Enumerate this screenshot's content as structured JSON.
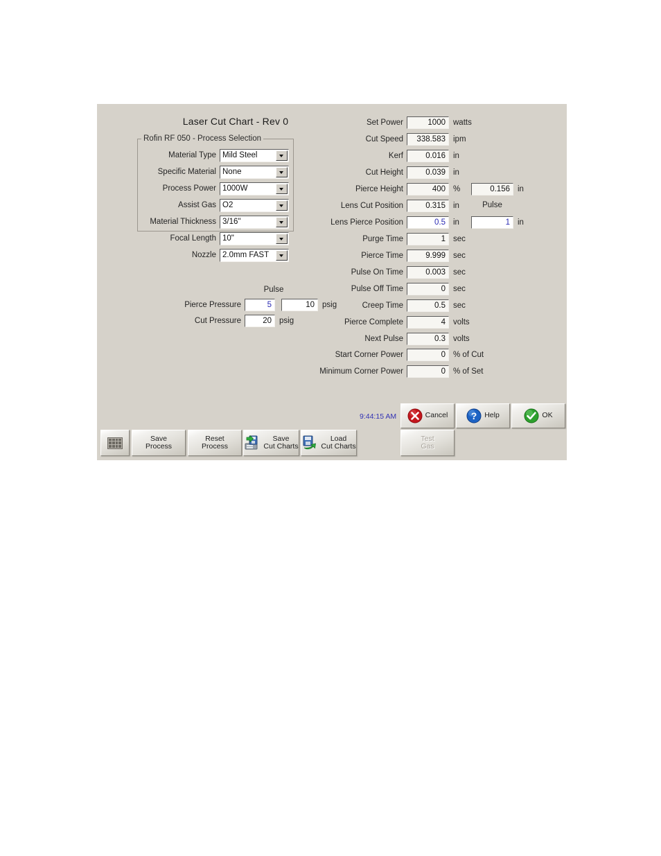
{
  "dialog": {
    "title": "Laser Cut Chart - Rev 0",
    "clock": "9:44:15 AM"
  },
  "process_selection": {
    "group_label": "Rofin RF 050 - Process Selection",
    "fields": [
      {
        "label": "Material Type",
        "value": "Mild Steel"
      },
      {
        "label": "Specific Material",
        "value": "None"
      },
      {
        "label": "Process Power",
        "value": "1000W"
      },
      {
        "label": "Assist Gas",
        "value": "O2"
      },
      {
        "label": "Material Thickness",
        "value": "3/16\""
      },
      {
        "label": "Focal Length",
        "value": "10\""
      },
      {
        "label": "Nozzle",
        "value": "2.0mm FAST"
      }
    ]
  },
  "pressure": {
    "pulse_header": "Pulse",
    "pierce": {
      "label": "Pierce Pressure",
      "value": "5",
      "pulse_value": "10",
      "unit": "psig"
    },
    "cut": {
      "label": "Cut Pressure",
      "value": "20",
      "unit": "psig"
    }
  },
  "parameters": [
    {
      "label": "Set Power",
      "value": "1000",
      "unit": "watts",
      "blue": false
    },
    {
      "label": "Cut Speed",
      "value": "338.583",
      "unit": "ipm",
      "blue": false
    },
    {
      "label": "Kerf",
      "value": "0.016",
      "unit": "in",
      "blue": false
    },
    {
      "label": "Cut Height",
      "value": "0.039",
      "unit": "in",
      "blue": false
    },
    {
      "label": "Pierce Height",
      "value": "400",
      "unit": "%",
      "blue": false
    },
    {
      "label": "Lens Cut Position",
      "value": "0.315",
      "unit": "in",
      "blue": false
    },
    {
      "label": "Lens Pierce Position",
      "value": "0.5",
      "unit": "in",
      "blue": true
    },
    {
      "label": "Purge Time",
      "value": "1",
      "unit": "sec",
      "blue": false
    },
    {
      "label": "Pierce Time",
      "value": "9.999",
      "unit": "sec",
      "blue": false
    },
    {
      "label": "Pulse On Time",
      "value": "0.003",
      "unit": "sec",
      "blue": false
    },
    {
      "label": "Pulse Off Time",
      "value": "0",
      "unit": "sec",
      "blue": false
    },
    {
      "label": "Creep Time",
      "value": "0.5",
      "unit": "sec",
      "blue": false
    },
    {
      "label": "Pierce Complete",
      "value": "4",
      "unit": "volts",
      "blue": false
    },
    {
      "label": "Next Pulse",
      "value": "0.3",
      "unit": "volts",
      "blue": false
    },
    {
      "label": "Start Corner Power",
      "value": "0",
      "unit": "% of Cut",
      "blue": false
    },
    {
      "label": "Minimum Corner Power",
      "value": "0",
      "unit": "% of Set",
      "blue": false
    }
  ],
  "secondary": {
    "pierce_height_abs": {
      "value": "0.156",
      "unit": "in"
    },
    "pulse_header": "Pulse",
    "lens_pierce_pulse": {
      "value": "1",
      "unit": "in",
      "blue": true
    }
  },
  "buttons": {
    "keyboard": {
      "label": "",
      "icon": "keyboard-icon"
    },
    "save_process": {
      "label": "Save\nProcess"
    },
    "reset_process": {
      "label": "Reset\nProcess"
    },
    "save_cut_charts": {
      "label": "Save\nCut Charts",
      "icon": "save-disk-icon"
    },
    "load_cut_charts": {
      "label": "Load\nCut Charts",
      "icon": "load-disk-icon"
    },
    "test_gas": {
      "label": "Test\nGas",
      "disabled": true
    },
    "cancel": {
      "label": "Cancel",
      "icon": "red-x-icon"
    },
    "help": {
      "label": "Help",
      "icon": "question-icon"
    },
    "ok": {
      "label": "OK",
      "icon": "green-check-icon"
    }
  },
  "colors": {
    "panel_bg": "#d6d2ca",
    "blue_text": "#2a2ab4",
    "cancel_red": "#c4161c",
    "help_blue": "#1d63c4",
    "ok_green": "#2da02d"
  }
}
